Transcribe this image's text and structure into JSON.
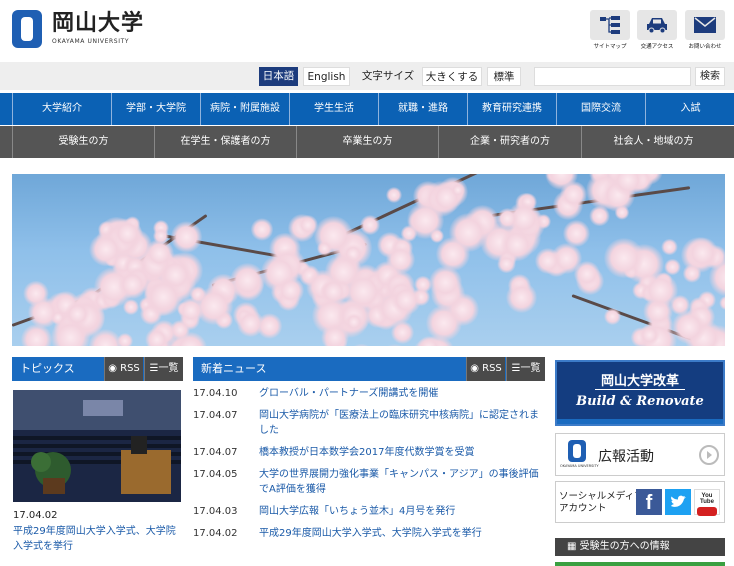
{
  "logo": {
    "jp": "岡山大学",
    "en": "OKAYAMA UNIVERSITY"
  },
  "quick_links": [
    {
      "label": "サイトマップ",
      "icon": "sitemap-icon"
    },
    {
      "label": "交通アクセス",
      "icon": "car-icon"
    },
    {
      "label": "お問い合わせ",
      "icon": "mail-icon"
    }
  ],
  "utility": {
    "lang_ja": "日本語",
    "lang_en": "English",
    "font_size_label": "文字サイズ",
    "bigger": "大きくする",
    "standard": "標準",
    "search_placeholder": "",
    "search_button": "検索"
  },
  "nav_main": [
    "大学紹介",
    "学部・大学院",
    "病院・附属施設",
    "学生生活",
    "就職・進路",
    "教育研究連携",
    "国際交流",
    "入試"
  ],
  "nav_audience": [
    "受験生の方",
    "在学生・保護者の方",
    "卒業生の方",
    "企業・研究者の方",
    "社会人・地域の方"
  ],
  "topics": {
    "title": "トピックス",
    "rss": "RSS",
    "list": "一覧",
    "date": "17.04.02",
    "headline": "平成29年度岡山大学入学式、大学院入学式を挙行"
  },
  "news": {
    "title": "新着ニュース",
    "rss": "RSS",
    "list": "一覧",
    "items": [
      {
        "date": "17.04.10",
        "title": "グローバル・パートナーズ開講式を開催"
      },
      {
        "date": "17.04.07",
        "title": "岡山大学病院が「医療法上の臨床研究中核病院」に認定されました"
      },
      {
        "date": "17.04.07",
        "title": "橋本教授が日本数学会2017年度代数学賞を受賞"
      },
      {
        "date": "17.04.05",
        "title": "大学の世界展開力強化事業「キャンパス・アジア」の事後評価でA評価を獲得"
      },
      {
        "date": "17.04.03",
        "title": "岡山大学広報「いちょう並木」4月号を発行"
      },
      {
        "date": "17.04.02",
        "title": "平成29年度岡山大学入学式、大学院入学式を挙行"
      }
    ]
  },
  "sidebar": {
    "reform_jp": "岡山大学改革",
    "reform_en": "Build & Renovate",
    "pr_label": "広報活動",
    "pr_logo_en": "OKAYAMA UNIVERSITY",
    "social_label_1": "ソーシャルメディア",
    "social_label_2": "アカウント",
    "youtube": "You Tube",
    "applicants": "受験生の方への情報"
  },
  "colors": {
    "nav_blue": "#0b61b4",
    "nav_gray": "#555555",
    "brand_navy": "#143d80"
  }
}
